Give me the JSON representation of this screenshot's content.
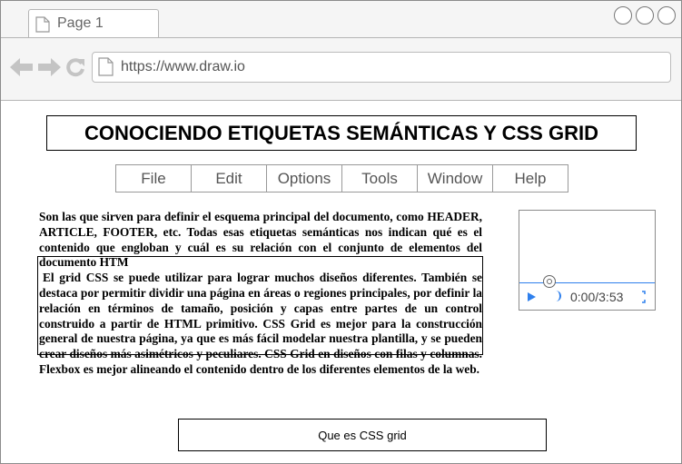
{
  "browser": {
    "tab_label": "Page 1",
    "url": "https://www.draw.io"
  },
  "page": {
    "title": "CONOCIENDO ETIQUETAS SEMÁNTICAS Y CSS GRID",
    "menu": [
      {
        "label": "File"
      },
      {
        "label": "Edit"
      },
      {
        "label": "Options"
      },
      {
        "label": "Tools"
      },
      {
        "label": "Window"
      },
      {
        "label": "Help"
      }
    ],
    "paragraphs": [
      "Son las que sirven para definir el esquema principal del documento, como HEADER, ARTICLE, FOOTER, etc. Todas esas etiquetas semánticas nos indican qué es el contenido que engloban y cuál es su relación con el conjunto de elementos del documento HTM",
      "El grid CSS se puede utilizar para lograr muchos diseños diferentes. También se destaca por permitir dividir una página en áreas o regiones principales, por definir la relación en términos de tamaño, posición y capas entre partes de un control construido a partir de HTML primitivo. CSS Grid es mejor para la construcción general de nuestra página, ya que es más fácil modelar nuestra plantilla, y se pueden crear diseños más asimétricos y peculiares. CSS Grid en diseños con filas y columnas. Flexbox es mejor alineando el contenido dentro de los diferentes elementos de la web."
    ],
    "video": {
      "time": "0:00/3:53"
    },
    "button_label": "Que es CSS grid"
  },
  "colors": {
    "accent": "#2f80ed",
    "chrome": "#f5f5f5"
  }
}
